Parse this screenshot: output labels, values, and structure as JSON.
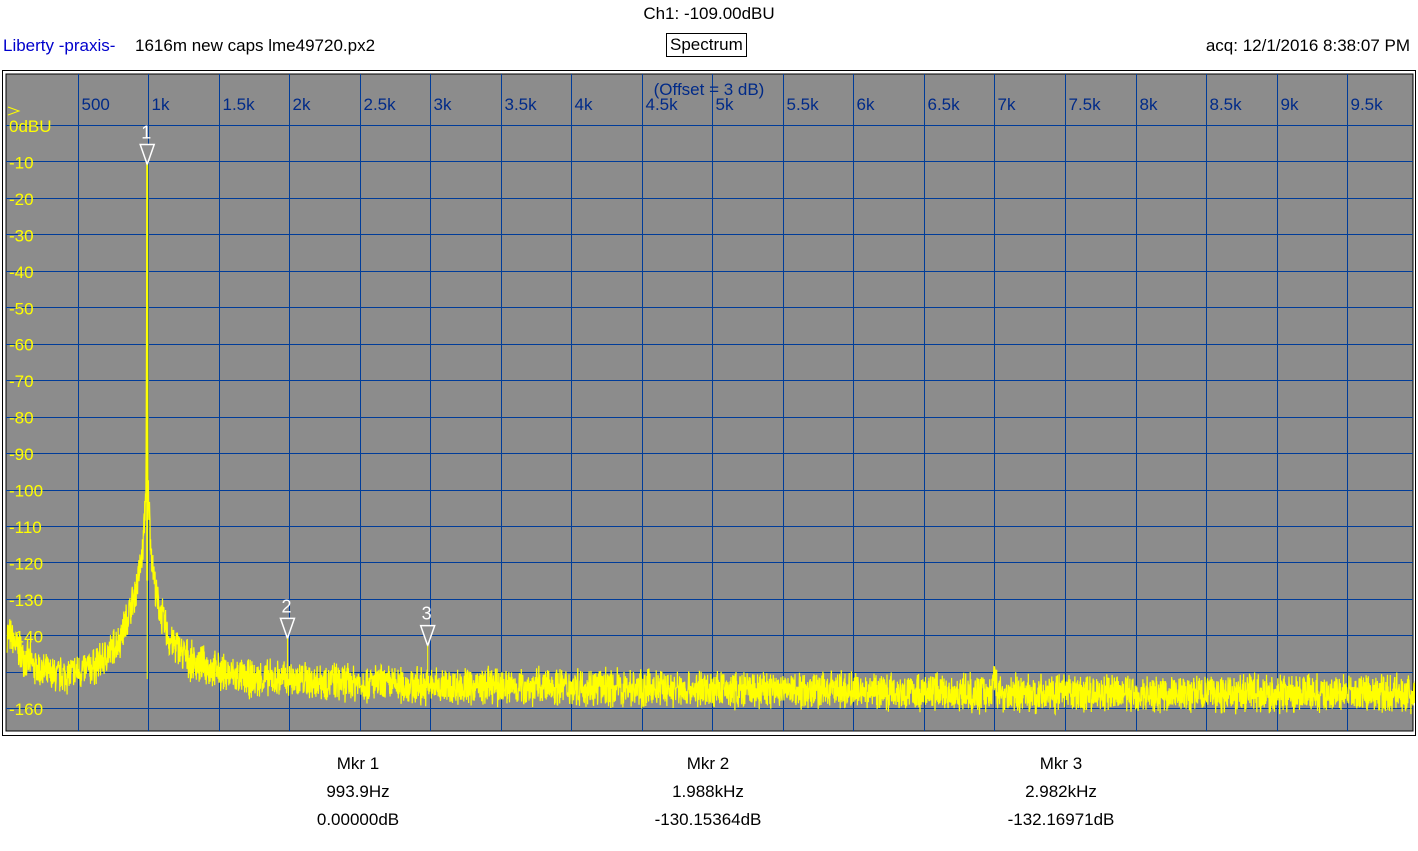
{
  "header": {
    "channel_readout": "Ch1: -109.00dBU",
    "app_name": "Liberty -praxis-",
    "file_name": "1616m new caps lme49720.px2",
    "mode_label": "Spectrum",
    "acquired": "acq: 12/1/2016 8:38:07 PM"
  },
  "chart_data": {
    "type": "line",
    "offset_label": "(Offset = 3 dB)",
    "x_tick_labels": [
      "500",
      "1k",
      "1.5k",
      "2k",
      "2.5k",
      "3k",
      "3.5k",
      "4k",
      "4.5k",
      "5k",
      "5.5k",
      "6k",
      "6.5k",
      "7k",
      "7.5k",
      "8k",
      "8.5k",
      "9k",
      "9.5k"
    ],
    "x_ticks_hz": [
      500,
      1000,
      1500,
      2000,
      2500,
      3000,
      3500,
      4000,
      4500,
      5000,
      5500,
      6000,
      6500,
      7000,
      7500,
      8000,
      8500,
      9000,
      9500
    ],
    "y_tick_labels": [
      "0dBU",
      "-10",
      "-20",
      "-30",
      "-40",
      "-50",
      "-60",
      "-70",
      "-80",
      "-90",
      "-100",
      "-110",
      "-120",
      "-130",
      "-140",
      "-160"
    ],
    "y_ticks_db": [
      0,
      -10,
      -20,
      -30,
      -40,
      -50,
      -60,
      -70,
      -80,
      -90,
      -100,
      -110,
      -120,
      -130,
      -140,
      -160
    ],
    "xlim_hz": [
      0,
      10000
    ],
    "ylim_db": [
      -165,
      3
    ],
    "series": [
      {
        "color": "#ffff00",
        "points_hz_db": [
          [
            0,
            -139
          ],
          [
            100,
            -145
          ],
          [
            200,
            -149
          ],
          [
            300,
            -151
          ],
          [
            400,
            -151
          ],
          [
            500,
            -150
          ],
          [
            600,
            -149
          ],
          [
            700,
            -146
          ],
          [
            800,
            -141
          ],
          [
            900,
            -130
          ],
          [
            960,
            -118
          ],
          [
            985,
            -100
          ],
          [
            993.9,
            -7
          ],
          [
            1000,
            -100
          ],
          [
            1025,
            -118
          ],
          [
            1060,
            -130
          ],
          [
            1150,
            -141
          ],
          [
            1300,
            -147
          ],
          [
            1500,
            -150
          ],
          [
            1700,
            -152
          ],
          [
            1988,
            -152
          ],
          [
            2500,
            -153
          ],
          [
            2982,
            -154
          ],
          [
            3500,
            -154
          ],
          [
            4000,
            -154
          ],
          [
            5000,
            -155
          ],
          [
            6000,
            -155
          ],
          [
            6980,
            -156
          ],
          [
            7000,
            -149
          ],
          [
            7020,
            -156
          ],
          [
            8000,
            -156
          ],
          [
            9000,
            -156
          ],
          [
            10000,
            -156
          ]
        ],
        "noise_band_db": 3
      }
    ],
    "markers": [
      {
        "id": "1",
        "freq_hz": 993.9,
        "db": -7
      },
      {
        "id": "2",
        "freq_hz": 1988,
        "db": -137
      },
      {
        "id": "3",
        "freq_hz": 2982,
        "db": -139
      }
    ],
    "grid": true,
    "background": "#8c8c8c",
    "grid_color": "#003c99",
    "axis_label_color": "#002a88"
  },
  "readouts": [
    {
      "name": "Mkr 1",
      "freq": "993.9Hz",
      "level": "0.00000dB"
    },
    {
      "name": "Mkr 2",
      "freq": "1.988kHz",
      "level": "-130.15364dB"
    },
    {
      "name": "Mkr 3",
      "freq": "2.982kHz",
      "level": "-132.16971dB"
    }
  ]
}
